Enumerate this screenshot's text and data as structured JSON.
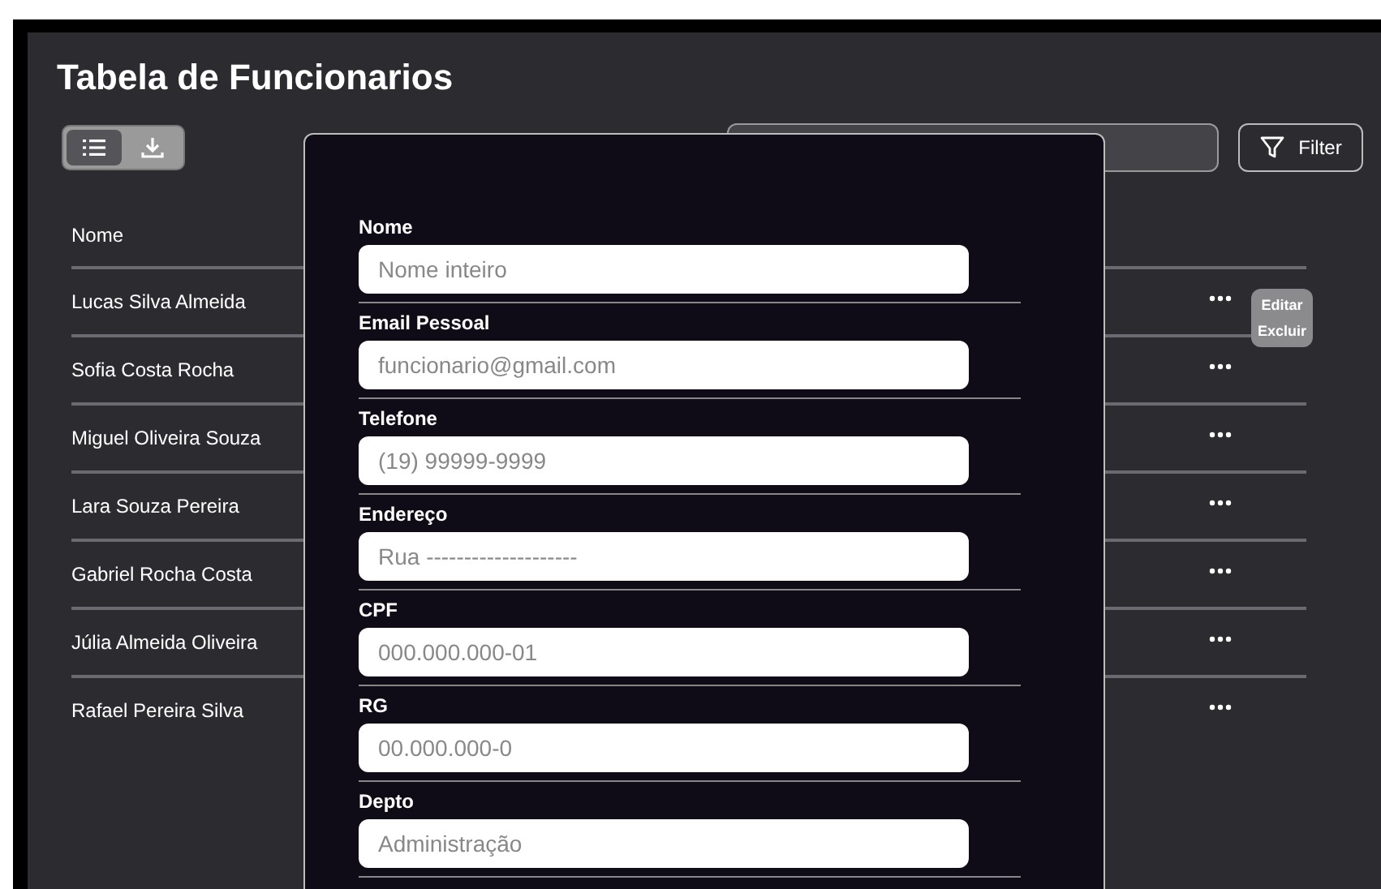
{
  "title": "Tabela de Funcionarios",
  "view_toggle": [
    {
      "kind": "list",
      "selected": true
    },
    {
      "kind": "download",
      "selected": false
    }
  ],
  "filter_button": {
    "label": "Filter"
  },
  "table": {
    "columns": [
      "Nome"
    ],
    "rows": [
      {
        "name": "Lucas Silva Almeida",
        "menu_open": true
      },
      {
        "name": "Sofia Costa Rocha",
        "menu_open": false
      },
      {
        "name": "Miguel Oliveira Souza",
        "menu_open": false
      },
      {
        "name": "Lara Souza Pereira",
        "menu_open": false
      },
      {
        "name": "Gabriel Rocha Costa",
        "menu_open": false
      },
      {
        "name": "Júlia Almeida Oliveira",
        "menu_open": false
      },
      {
        "name": "Rafael Pereira Silva",
        "menu_open": false
      }
    ]
  },
  "row_menu": {
    "items": [
      "Editar",
      "Excluir"
    ]
  },
  "form": {
    "fields": [
      {
        "label": "Nome",
        "placeholder": "Nome inteiro"
      },
      {
        "label": "Email Pessoal",
        "placeholder": "funcionario@gmail.com"
      },
      {
        "label": "Telefone",
        "placeholder": "(19) 99999-9999"
      },
      {
        "label": "Endereço",
        "placeholder": "Rua --------------------"
      },
      {
        "label": "CPF",
        "placeholder": "000.000.000-01"
      },
      {
        "label": "RG",
        "placeholder": "00.000.000-0"
      },
      {
        "label": "Depto",
        "placeholder": "Administração"
      }
    ]
  }
}
